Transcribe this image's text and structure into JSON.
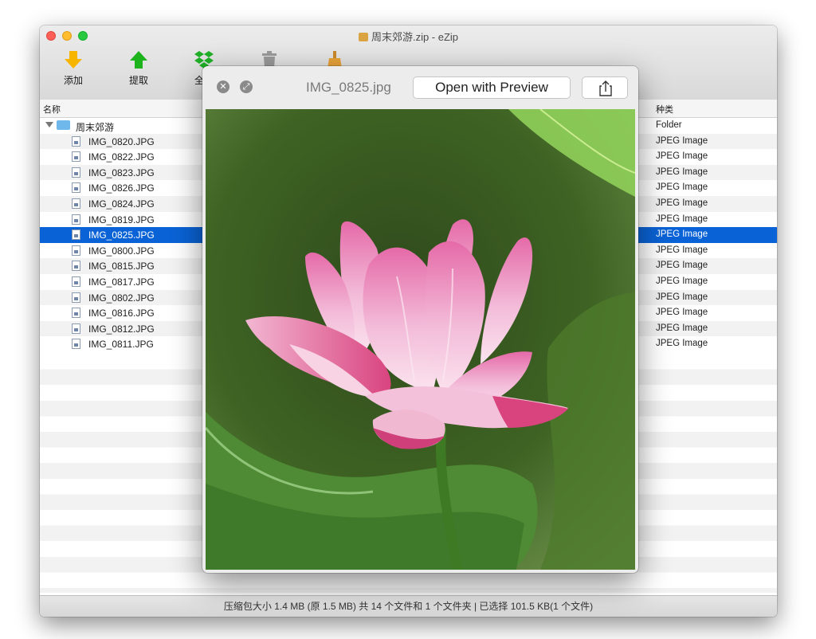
{
  "window": {
    "title": "周末郊游.zip - eZip"
  },
  "toolbar": {
    "items": [
      {
        "label": "添加",
        "icon": "add-arrow-down-icon",
        "color": "#f7b500"
      },
      {
        "label": "提取",
        "icon": "extract-arrow-up-icon",
        "color": "#1db31d"
      },
      {
        "label": "全部",
        "icon": "dropbox-icon",
        "color": "#1fb027"
      },
      {
        "label": "",
        "icon": "trash-icon",
        "color": "#9a9a9a"
      },
      {
        "label": "",
        "icon": "broom-icon",
        "color": "#e8a33a"
      }
    ]
  },
  "columns": {
    "name": "名称",
    "kind": "种类"
  },
  "files": [
    {
      "name": "周末郊游",
      "kind": "Folder",
      "type": "folder"
    },
    {
      "name": "IMG_0820.JPG",
      "kind": "JPEG Image"
    },
    {
      "name": "IMG_0822.JPG",
      "kind": "JPEG Image"
    },
    {
      "name": "IMG_0823.JPG",
      "kind": "JPEG Image"
    },
    {
      "name": "IMG_0826.JPG",
      "kind": "JPEG Image"
    },
    {
      "name": "IMG_0824.JPG",
      "kind": "JPEG Image"
    },
    {
      "name": "IMG_0819.JPG",
      "kind": "JPEG Image"
    },
    {
      "name": "IMG_0825.JPG",
      "kind": "JPEG Image",
      "selected": true
    },
    {
      "name": "IMG_0800.JPG",
      "kind": "JPEG Image"
    },
    {
      "name": "IMG_0815.JPG",
      "kind": "JPEG Image"
    },
    {
      "name": "IMG_0817.JPG",
      "kind": "JPEG Image"
    },
    {
      "name": "IMG_0802.JPG",
      "kind": "JPEG Image"
    },
    {
      "name": "IMG_0816.JPG",
      "kind": "JPEG Image"
    },
    {
      "name": "IMG_0812.JPG",
      "kind": "JPEG Image"
    },
    {
      "name": "IMG_0811.JPG",
      "kind": "JPEG Image"
    }
  ],
  "status": {
    "text": "压缩包大小 1.4 MB (原 1.5 MB) 共 14 个文件和 1 个文件夹  |  已选择 101.5 KB(1 个文件)"
  },
  "quicklook": {
    "filename": "IMG_0825.jpg",
    "open_label": "Open with Preview",
    "close_icon": "close-icon",
    "fullscreen_icon": "fullscreen-icon",
    "share_icon": "share-icon",
    "image_subject": "pink-lotus-flower"
  },
  "colors": {
    "selection": "#0a63d6"
  }
}
